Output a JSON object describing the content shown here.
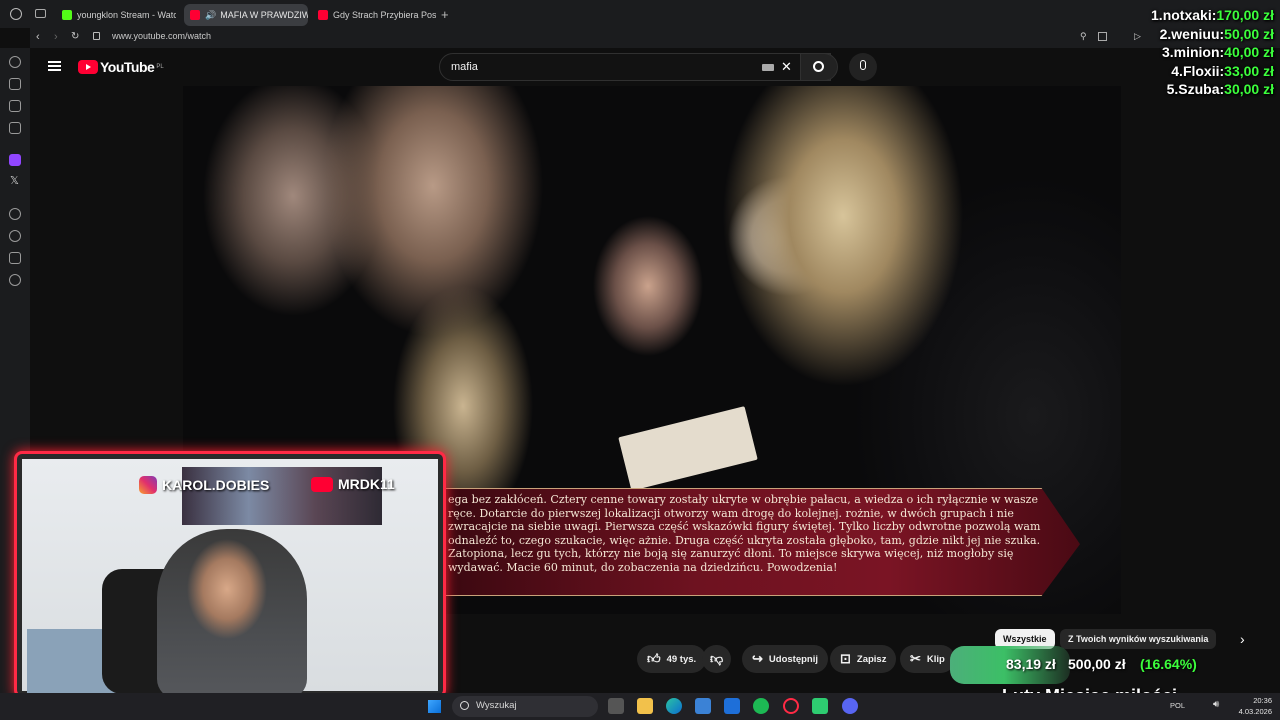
{
  "browser": {
    "tabs": [
      {
        "label": "youngklon Stream - Watch",
        "color": "#53fc18",
        "active": false
      },
      {
        "label": "MAFIA W PRAWDZIWYM",
        "color": "#ff0033",
        "active": true
      },
      {
        "label": "Gdy Strach Przybiera Posta",
        "color": "#ff0033",
        "active": false
      }
    ],
    "url": "www.youtube.com/watch"
  },
  "youtube": {
    "logo_text": "YouTube",
    "region": "PL",
    "search_value": "mafia"
  },
  "video": {
    "subtitle": "ega bez zakłóceń. Cztery cenne towary zostały ukryte w obrębie pałacu, a wiedza o ich ryłącznie w wasze ręce. Dotarcie do pierwszej lokalizacji otworzy wam drogę do kolejnej. rożnie, w dwóch grupach i nie zwracajcie na siebie uwagi. Pierwsza część wskazówki figury świętej. Tylko liczby odwrotne pozwolą wam odnaleźć to, czego szukacie, więc ażnie. Druga część ukryta została głęboko, tam, gdzie nikt jej nie szuka. Zatopiona, lecz gu tych, którzy nie boją się zanurzyć dłoni. To miejsce skrywa więcej, niż mogłoby się wydawać. Macie 60 minut, do zobaczenia na dziedzińcu. Powodzenia!"
  },
  "donations": [
    {
      "rank": "1.",
      "name": "notxaki:",
      "amount": "170,00 zł"
    },
    {
      "rank": "2.",
      "name": "weniuu:",
      "amount": "50,00 zł"
    },
    {
      "rank": "3.",
      "name": "minion:",
      "amount": "40,00 zł"
    },
    {
      "rank": "4.",
      "name": "Floxii:",
      "amount": "33,00 zł"
    },
    {
      "rank": "5.",
      "name": "Szuba:",
      "amount": "30,00 zł"
    }
  ],
  "webcam": {
    "instagram": "KAROL.DOBIES",
    "youtube": "MRDK11"
  },
  "actions": {
    "likes": "49 tys.",
    "share": "Udostępnij",
    "save": "Zapisz",
    "clip": "Klip"
  },
  "chips": {
    "all": "Wszystkie",
    "from_search": "Z Twoich wyników wyszukiwania"
  },
  "goal": {
    "current": "83,19 zł",
    "target": "500,00 zł",
    "percent": "(16.64%)",
    "title": "Luty Miesiąc miłości"
  },
  "taskbar": {
    "search_placeholder": "Wyszukaj",
    "lang": "POL",
    "time": "20:36",
    "date": "4.03.2026"
  },
  "colors": {
    "accent_red": "#ff2a45",
    "donation_green": "#3cff3c"
  }
}
